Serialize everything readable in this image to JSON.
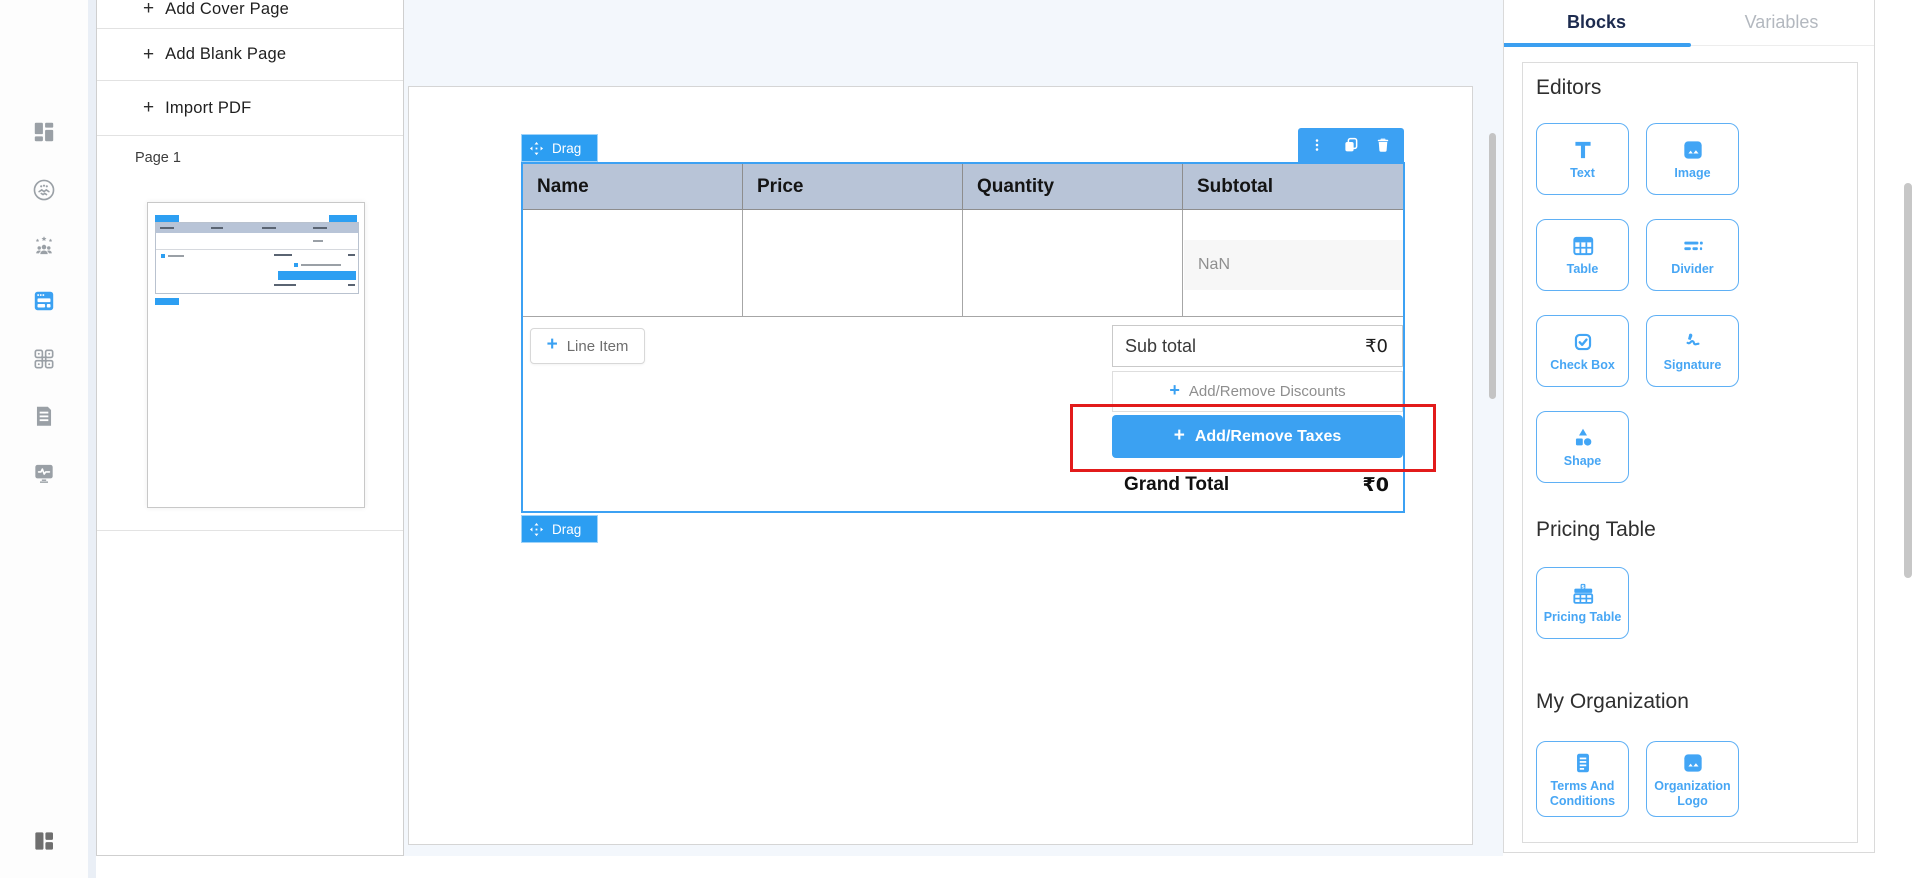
{
  "glyphs": {
    "plus": "+"
  },
  "colors": {
    "accent": "#3ba1f2",
    "table_header_fill": "#b8c4d7",
    "annotation_red": "#e21b1b"
  },
  "sidebar": {
    "icons": [
      {
        "name": "dashboard-icon",
        "active": false
      },
      {
        "name": "handshake-deals-icon",
        "active": false
      },
      {
        "name": "team-icon",
        "active": false
      },
      {
        "name": "document-builder-icon",
        "active": true
      },
      {
        "name": "integrations-icon",
        "active": false
      },
      {
        "name": "forms-icon",
        "active": false
      },
      {
        "name": "activity-monitor-icon",
        "active": false
      },
      {
        "name": "workspace-layout-icon",
        "active": false
      }
    ]
  },
  "left_panel": {
    "add_cover_page": "Add Cover Page",
    "add_blank_page": "Add Blank Page",
    "import_pdf": "Import PDF",
    "page_label": "Page 1"
  },
  "canvas": {
    "drag_label": "Drag",
    "pricing_table": {
      "headers": [
        "Name",
        "Price",
        "Quantity",
        "Subtotal"
      ],
      "empty_subtotal": "NaN",
      "line_item": "Line Item",
      "sub_total_label": "Sub total",
      "sub_total_value": "₹0",
      "discounts_label": "Add/Remove Discounts",
      "taxes_label": "Add/Remove Taxes",
      "grand_total_label": "Grand Total",
      "grand_total_value": "₹0"
    }
  },
  "right_panel": {
    "tabs": {
      "blocks": "Blocks",
      "variables": "Variables"
    },
    "editors": {
      "title": "Editors",
      "blocks": [
        {
          "label": "Text"
        },
        {
          "label": "Image"
        },
        {
          "label": "Table"
        },
        {
          "label": "Divider"
        },
        {
          "label": "Check Box"
        },
        {
          "label": "Signature"
        },
        {
          "label": "Shape"
        }
      ]
    },
    "pricing": {
      "title": "Pricing Table",
      "blocks": [
        {
          "label": "Pricing Table"
        }
      ]
    },
    "organization": {
      "title": "My Organization",
      "blocks": [
        {
          "label": "Terms And Conditions"
        },
        {
          "label": "Organization Logo"
        }
      ]
    }
  }
}
